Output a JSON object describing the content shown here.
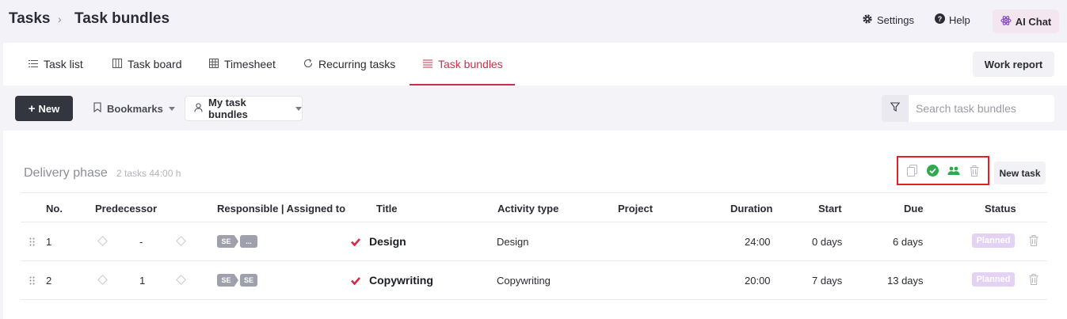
{
  "breadcrumb": {
    "root": "Tasks",
    "separator": "›",
    "current": "Task bundles"
  },
  "header": {
    "settings_label": "Settings",
    "help_label": "Help",
    "ai_chat_label": "AI Chat",
    "ai_chat_bg": "#f4e6ee"
  },
  "tabs": [
    {
      "label": "Task list",
      "icon": "list-icon"
    },
    {
      "label": "Task board",
      "icon": "board-icon"
    },
    {
      "label": "Timesheet",
      "icon": "grid-icon"
    },
    {
      "label": "Recurring tasks",
      "icon": "refresh-icon"
    },
    {
      "label": "Task bundles",
      "icon": "bundle-list-icon",
      "active": true
    }
  ],
  "work_report_label": "Work report",
  "toolbar": {
    "new_label": "New",
    "bookmarks_label": "Bookmarks",
    "bundle_filter_value": "My task bundles",
    "search_placeholder": "Search task bundles"
  },
  "bundle": {
    "name": "Delivery phase",
    "task_count": "2 tasks",
    "total_hours": "44:00 h",
    "new_task_label": "New task"
  },
  "table": {
    "columns": [
      "No.",
      "Predecessor",
      "Responsible | Assigned to",
      "Title",
      "Activity type",
      "Project",
      "Duration",
      "Start",
      "Due",
      "Status"
    ],
    "rows": [
      {
        "no": "1",
        "predecessor": "-",
        "responsible": "SE",
        "assigned": "...",
        "title": "Design",
        "activity": "Design",
        "project": "",
        "duration": "24:00",
        "start": "0 days",
        "due": "6 days",
        "status": "Planned"
      },
      {
        "no": "2",
        "predecessor": "1",
        "responsible": "SE",
        "assigned": "SE",
        "title": "Copywriting",
        "activity": "Copywriting",
        "project": "",
        "duration": "20:00",
        "start": "7 days",
        "due": "13 days",
        "status": "Planned"
      }
    ]
  },
  "colors": {
    "accent": "#c8304a",
    "highlight_box": "#e0212b",
    "status_planned": "#e4d2f5",
    "dark_button": "#33363f"
  }
}
